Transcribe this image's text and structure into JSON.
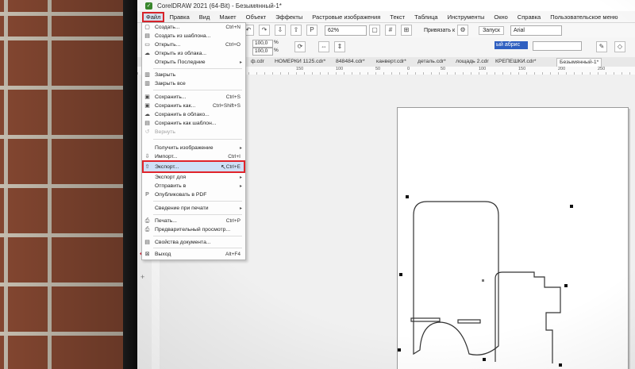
{
  "window": {
    "title": "CorelDRAW 2021 (64-Bit) - Безымянный-1*",
    "logo_icon": "coreldraw-logo-icon"
  },
  "menubar": [
    "Файл",
    "Правка",
    "Вид",
    "Макет",
    "Объект",
    "Эффекты",
    "Растровые изображения",
    "Текст",
    "Таблица",
    "Инструменты",
    "Окно",
    "Справка",
    "Пользовательское меню"
  ],
  "toolbar": {
    "zoom": "62%",
    "snap_label": "Привязать к",
    "launch_label": "Запуск",
    "font": "Arial"
  },
  "propbar": {
    "w_pct": "100,0",
    "h_pct": "100,0",
    "pct_sign": "%",
    "font_name": "ый абрис"
  },
  "doc_tabs": [
    "ф.cdr",
    "НОМЕРКИ 1125.cdr*",
    "848484.cdr*",
    "канверт.cdr*",
    "деталь.cdr*",
    "лощадь 2.cdr",
    "КРЕПЕШКИ.cdr*",
    "Безымянный-1*"
  ],
  "ruler_marks": [
    "150",
    "100",
    "50",
    "0",
    "50",
    "100",
    "150",
    "200",
    "250"
  ],
  "file_menu": {
    "items": [
      {
        "label": "Создать...",
        "shortcut": "Ctrl+N",
        "icon": "new-doc-icon"
      },
      {
        "label": "Создать из шаблона...",
        "shortcut": "",
        "icon": "template-icon"
      },
      {
        "label": "Открыть...",
        "shortcut": "Ctrl+O",
        "icon": "open-folder-icon"
      },
      {
        "label": "Открыть из облака...",
        "shortcut": "",
        "icon": "cloud-icon"
      },
      {
        "label": "Открыть Последние",
        "shortcut": "",
        "icon": "",
        "submenu": "▸"
      },
      {
        "label": "Закрыть",
        "shortcut": "",
        "icon": "close-doc-icon"
      },
      {
        "label": "Закрыть все",
        "shortcut": "",
        "icon": "close-all-icon"
      },
      {
        "label": "Сохранить...",
        "shortcut": "Ctrl+S",
        "icon": "save-icon"
      },
      {
        "label": "Сохранить как...",
        "shortcut": "Ctrl+Shift+S",
        "icon": "save-as-icon"
      },
      {
        "label": "Сохранить в облако...",
        "shortcut": "",
        "icon": "cloud-save-icon"
      },
      {
        "label": "Сохранить как шаблон...",
        "shortcut": "",
        "icon": "save-template-icon"
      },
      {
        "label": "Вернуть",
        "shortcut": "",
        "icon": "revert-icon",
        "disabled": true
      },
      {
        "label": "Получить изображение",
        "shortcut": "",
        "icon": "",
        "submenu": "▸"
      },
      {
        "label": "Импорт...",
        "shortcut": "Ctrl+I",
        "icon": "import-icon"
      },
      {
        "label": "Экспорт...",
        "shortcut": "Ctrl+E",
        "icon": "export-icon"
      },
      {
        "label": "Экспорт для",
        "shortcut": "",
        "icon": "",
        "submenu": "▸"
      },
      {
        "label": "Отправить в",
        "shortcut": "",
        "icon": "",
        "submenu": "▸"
      },
      {
        "label": "Опубликовать в PDF",
        "shortcut": "",
        "icon": "pdf-icon"
      },
      {
        "label": "Сведение при печати",
        "shortcut": "",
        "icon": "",
        "submenu": "▸"
      },
      {
        "label": "Печать...",
        "shortcut": "Ctrl+P",
        "icon": "print-icon"
      },
      {
        "label": "Предварительный просмотр...",
        "shortcut": "",
        "icon": "print-preview-icon"
      },
      {
        "label": "Свойства документа...",
        "shortcut": "",
        "icon": "doc-properties-icon"
      },
      {
        "label": "Выход",
        "shortcut": "Alt+F4",
        "icon": "exit-icon"
      }
    ]
  },
  "colors": {
    "highlight": "#e0242b",
    "accent": "#2f5fc0",
    "selected_bg": "#cfe0f7"
  }
}
